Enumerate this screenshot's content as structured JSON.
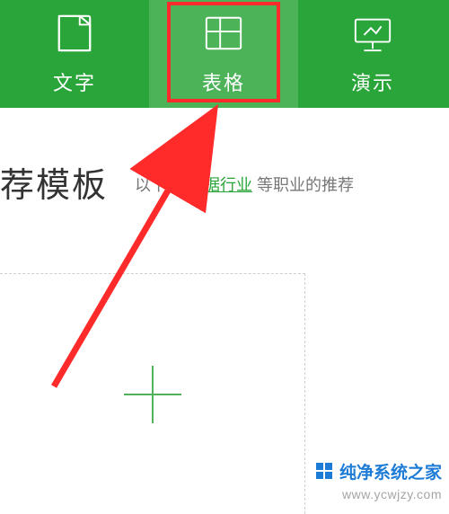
{
  "colors": {
    "accent": "#2aa53a",
    "callout": "#ff2a2a",
    "link": "#29a538"
  },
  "tabs": [
    {
      "id": "writer",
      "label": "文字",
      "icon": "doc-icon",
      "selected": false
    },
    {
      "id": "sheet",
      "label": "表格",
      "icon": "grid-icon",
      "selected": true
    },
    {
      "id": "presenter",
      "label": "演示",
      "icon": "screen-icon",
      "selected": false
    }
  ],
  "heading": "荐模板",
  "subtitle_prefix": "以下是 ",
  "subtitle_link": "根据行业",
  "subtitle_suffix": " 等职业的推荐",
  "new_card_aria": "新建空白表格",
  "watermark_brand": "纯净系统之家",
  "watermark_url": "www.ycwjzy.com"
}
